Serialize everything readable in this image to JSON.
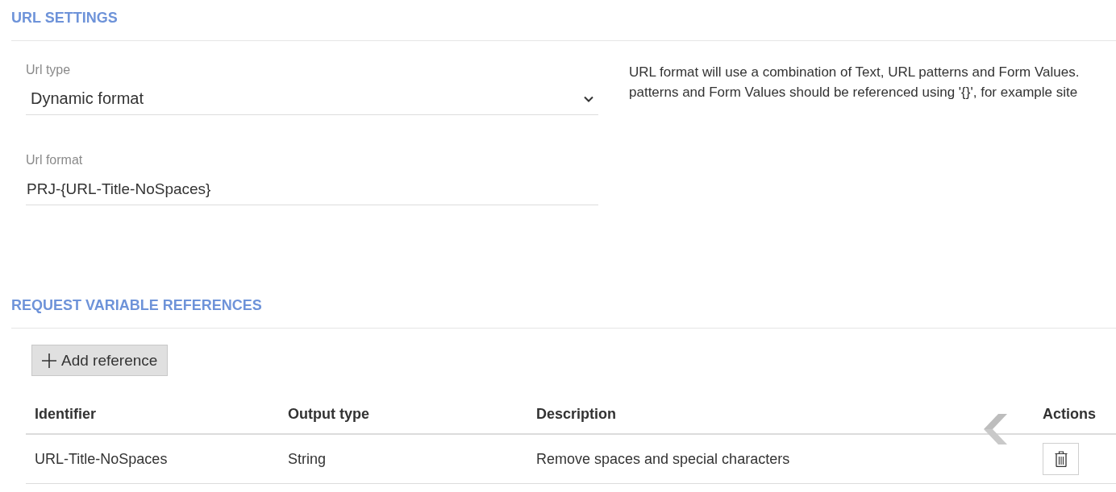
{
  "url_settings": {
    "title": "URL SETTINGS",
    "url_type": {
      "label": "Url type",
      "value": "Dynamic format"
    },
    "url_format": {
      "label": "Url format",
      "value": "PRJ-{URL-Title-NoSpaces}"
    },
    "help_text_lines": [
      "URL format will use a combination of Text, URL patterns and Form Values.",
      "patterns and Form Values should be referenced using '{}', for example site"
    ]
  },
  "request_variable_references": {
    "title": "REQUEST VARIABLE REFERENCES",
    "add_button": "Add reference",
    "table": {
      "columns": [
        "Identifier",
        "Output type",
        "Description",
        "Actions"
      ],
      "rows": [
        {
          "cells": [
            "URL-Title-NoSpaces",
            "String",
            "Remove spaces and special characters"
          ]
        }
      ]
    }
  }
}
